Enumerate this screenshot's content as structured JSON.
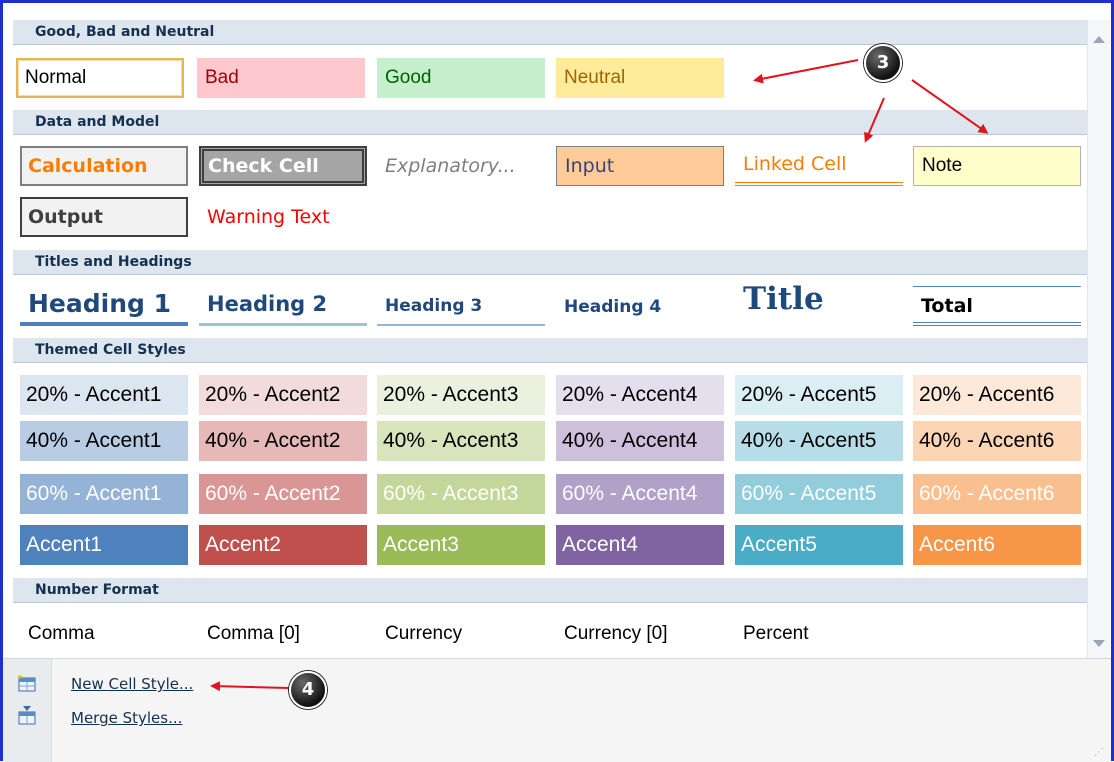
{
  "sections": {
    "good_bad_neutral": {
      "title": "Good, Bad and Neutral",
      "styles": [
        "Normal",
        "Bad",
        "Good",
        "Neutral"
      ]
    },
    "data_model": {
      "title": "Data and Model",
      "styles": [
        "Calculation",
        "Check Cell",
        "Explanatory...",
        "Input",
        "Linked Cell",
        "Note",
        "Output",
        "Warning Text"
      ]
    },
    "titles": {
      "title": "Titles and Headings",
      "styles": [
        "Heading 1",
        "Heading 2",
        "Heading 3",
        "Heading 4",
        "Title",
        "Total"
      ]
    },
    "themed": {
      "title": "Themed Cell Styles",
      "row20": [
        "20% - Accent1",
        "20% - Accent2",
        "20% - Accent3",
        "20% - Accent4",
        "20% - Accent5",
        "20% - Accent6"
      ],
      "row40": [
        "40% - Accent1",
        "40% - Accent2",
        "40% - Accent3",
        "40% - Accent4",
        "40% - Accent5",
        "40% - Accent6"
      ],
      "row60": [
        "60% - Accent1",
        "60% - Accent2",
        "60% - Accent3",
        "60% - Accent4",
        "60% - Accent5",
        "60% - Accent6"
      ],
      "rowAccent": [
        "Accent1",
        "Accent2",
        "Accent3",
        "Accent4",
        "Accent5",
        "Accent6"
      ]
    },
    "number_format": {
      "title": "Number Format",
      "styles": [
        "Comma",
        "Comma [0]",
        "Currency",
        "Currency [0]",
        "Percent"
      ]
    }
  },
  "commands": {
    "new_style": "New Cell Style...",
    "merge_styles": "Merge Styles..."
  },
  "callouts": {
    "three": "3",
    "four": "4"
  },
  "colors": {
    "frame": "#1e2fd0",
    "header_bg": "#dde6ee",
    "arrow": "#e0141e",
    "accent1": "#4f81bd",
    "accent2": "#c0504d",
    "accent3": "#9bbb59",
    "accent4": "#8064a2",
    "accent5": "#4bacc6",
    "accent6": "#f79646"
  },
  "icons": {
    "new_style": "new-cell-style-icon",
    "merge_styles": "merge-styles-icon",
    "scroll_up": "scroll-up-arrow-icon",
    "scroll_down": "scroll-down-arrow-icon"
  }
}
